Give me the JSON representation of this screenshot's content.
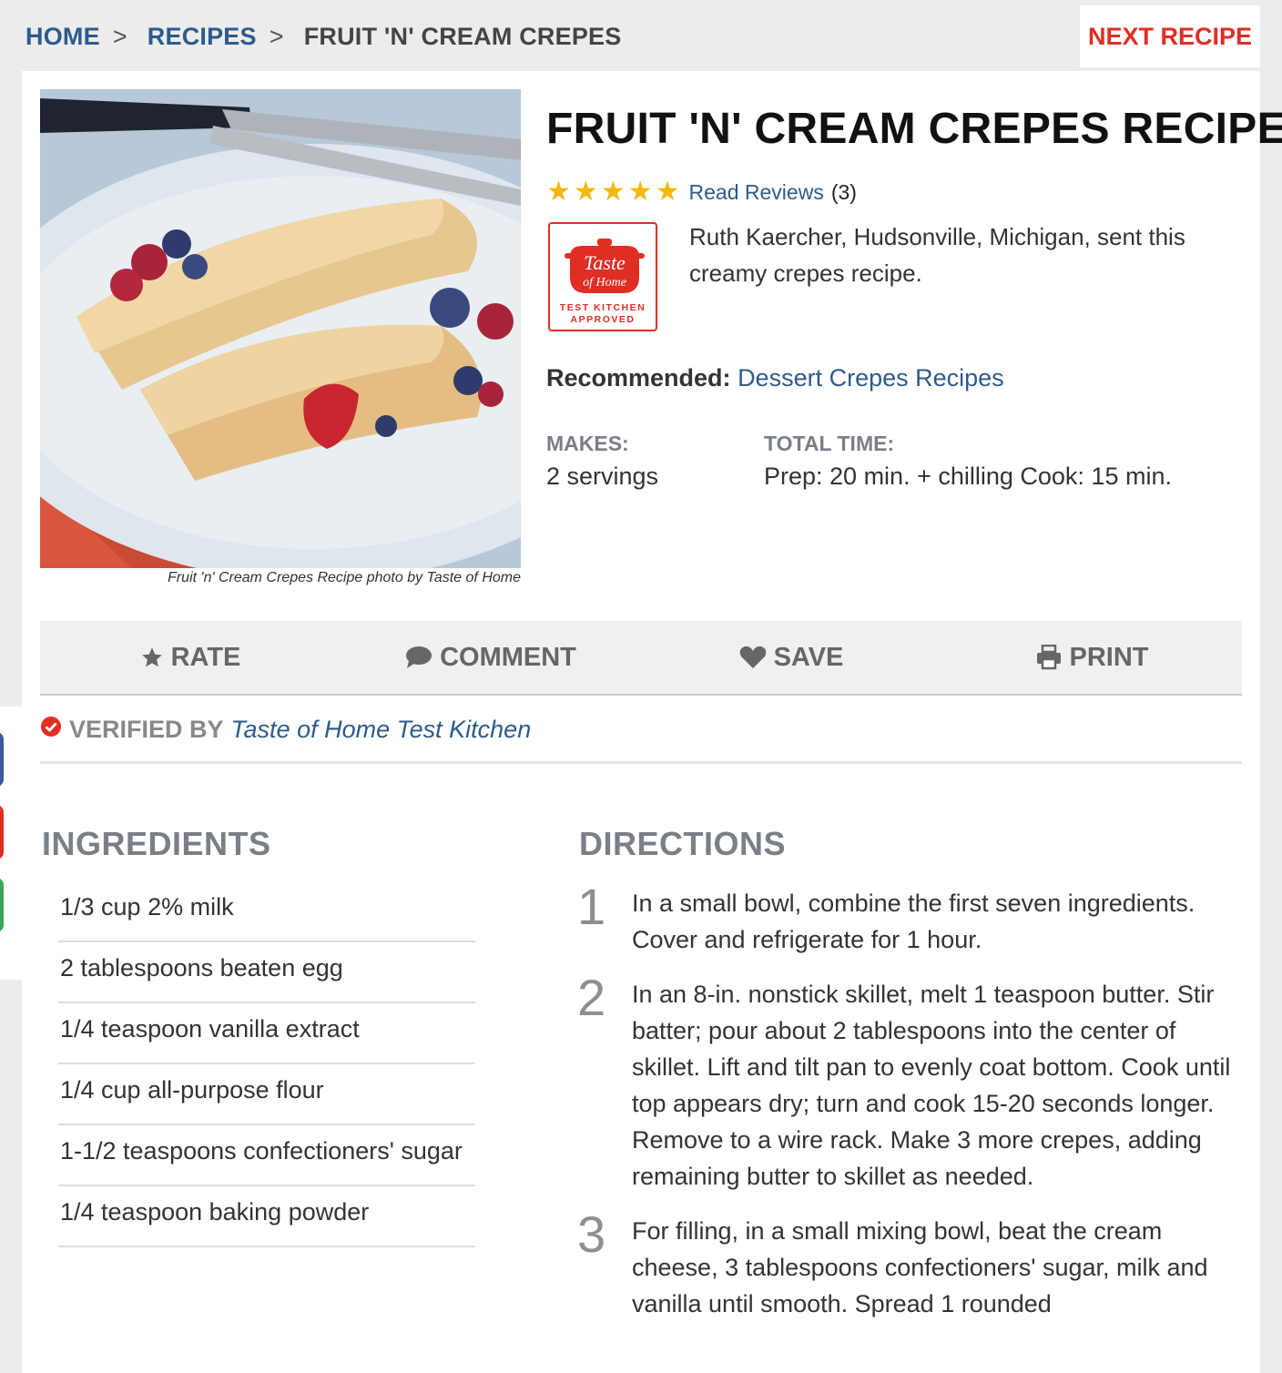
{
  "breadcrumb": {
    "items": [
      "HOME",
      "RECIPES"
    ],
    "current": "FRUIT 'N' CREAM CREPES",
    "separator": ">"
  },
  "next_recipe": "NEXT RECIPE",
  "recipe": {
    "title": "FRUIT 'N' CREAM CREPES RECIPE",
    "rating": {
      "stars": 5,
      "reviews_label": "Read Reviews",
      "reviews_count": "(3)"
    },
    "badge": {
      "logo_line1": "Taste",
      "logo_line2": "of Home",
      "line1": "TEST KITCHEN",
      "line2": "APPROVED"
    },
    "description": "Ruth Kaercher, Hudsonville, Michigan, sent this creamy crepes recipe.",
    "recommended_label": "Recommended:",
    "recommended_link": "Dessert Crepes Recipes",
    "makes_label": "MAKES:",
    "makes_value": "2 servings",
    "time_label": "TOTAL TIME:",
    "time_value": "Prep: 20 min. + chilling Cook: 15 min.",
    "photo_caption": "Fruit 'n' Cream Crepes Recipe photo by Taste of Home"
  },
  "actions": {
    "rate": "RATE",
    "comment": "COMMENT",
    "save": "SAVE",
    "print": "PRINT"
  },
  "verified": {
    "label": "VERIFIED BY",
    "by": "Taste of Home Test Kitchen"
  },
  "ingredients": {
    "heading": "INGREDIENTS",
    "items": [
      "1/3 cup 2% milk",
      "2 tablespoons beaten egg",
      "1/4 teaspoon vanilla extract",
      "1/4 cup all-purpose flour",
      "1-1/2 teaspoons confectioners' sugar",
      "1/4 teaspoon baking powder"
    ]
  },
  "directions": {
    "heading": "DIRECTIONS",
    "steps": [
      {
        "num": "1",
        "text": "In a small bowl, combine the first seven ingredients. Cover and refrigerate for 1 hour."
      },
      {
        "num": "2",
        "text": "In an 8-in. nonstick skillet, melt 1 teaspoon butter. Stir batter; pour about 2 tablespoons into the center of skillet. Lift and tilt pan to evenly coat bottom. Cook until top appears dry; turn and cook 15-20 seconds longer. Remove to a wire rack. Make 3 more crepes, adding remaining butter to skillet as needed."
      },
      {
        "num": "3",
        "text": "For filling, in a small mixing bowl, beat the cream cheese, 3 tablespoons confectioners' sugar, milk and vanilla until smooth. Spread 1 rounded"
      }
    ]
  },
  "colors": {
    "link": "#2d5b8c",
    "accent_red": "#e02e24",
    "star": "#f5b80f",
    "social": [
      "#3b5998",
      "#e02e24",
      "#3aa657"
    ]
  },
  "icons": {
    "rate": "star-icon",
    "comment": "comment-icon",
    "save": "heart-icon",
    "print": "print-icon",
    "verified": "check-circle-icon"
  }
}
